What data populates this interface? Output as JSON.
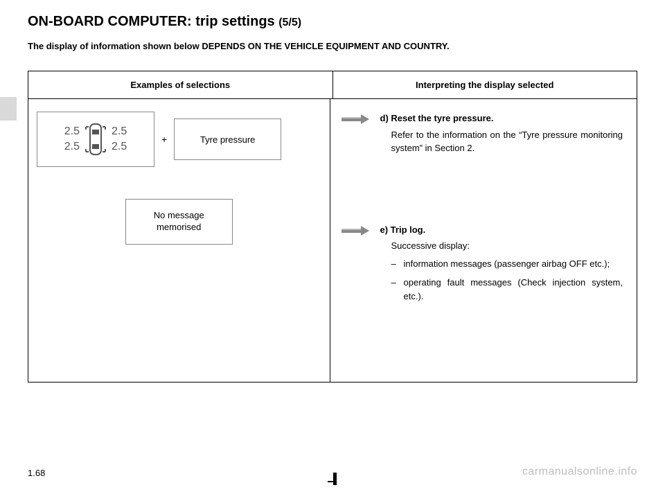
{
  "title_main": "ON-BOARD COMPUTER: trip settings ",
  "title_sub": "(5/5)",
  "subtitle": "The display of information shown below DEPENDS ON THE VEHICLE EQUIPMENT AND COUNTRY.",
  "table": {
    "head_left": "Examples of selections",
    "head_right": "Interpreting the display selected"
  },
  "row1": {
    "tyre_values": {
      "fl": "2.5",
      "fr": "2.5",
      "rl": "2.5",
      "rr": "2.5"
    },
    "plus": "+",
    "tyre_label": "Tyre pressure",
    "right_key": "d) Reset the tyre pressure.",
    "right_body": "Refer to the information on the “Tyre pressure monitoring system” in Section 2."
  },
  "row2": {
    "box_line1": "No message",
    "box_line2": "memorised",
    "right_key": "e) Trip log.",
    "right_sub": "Successive display:",
    "list_item1": "information messages (passenger airbag OFF etc.);",
    "list_item2": "operating fault messages (Check injection system, etc.)."
  },
  "page_number": "1.68",
  "watermark": "carmanualsonline.info"
}
